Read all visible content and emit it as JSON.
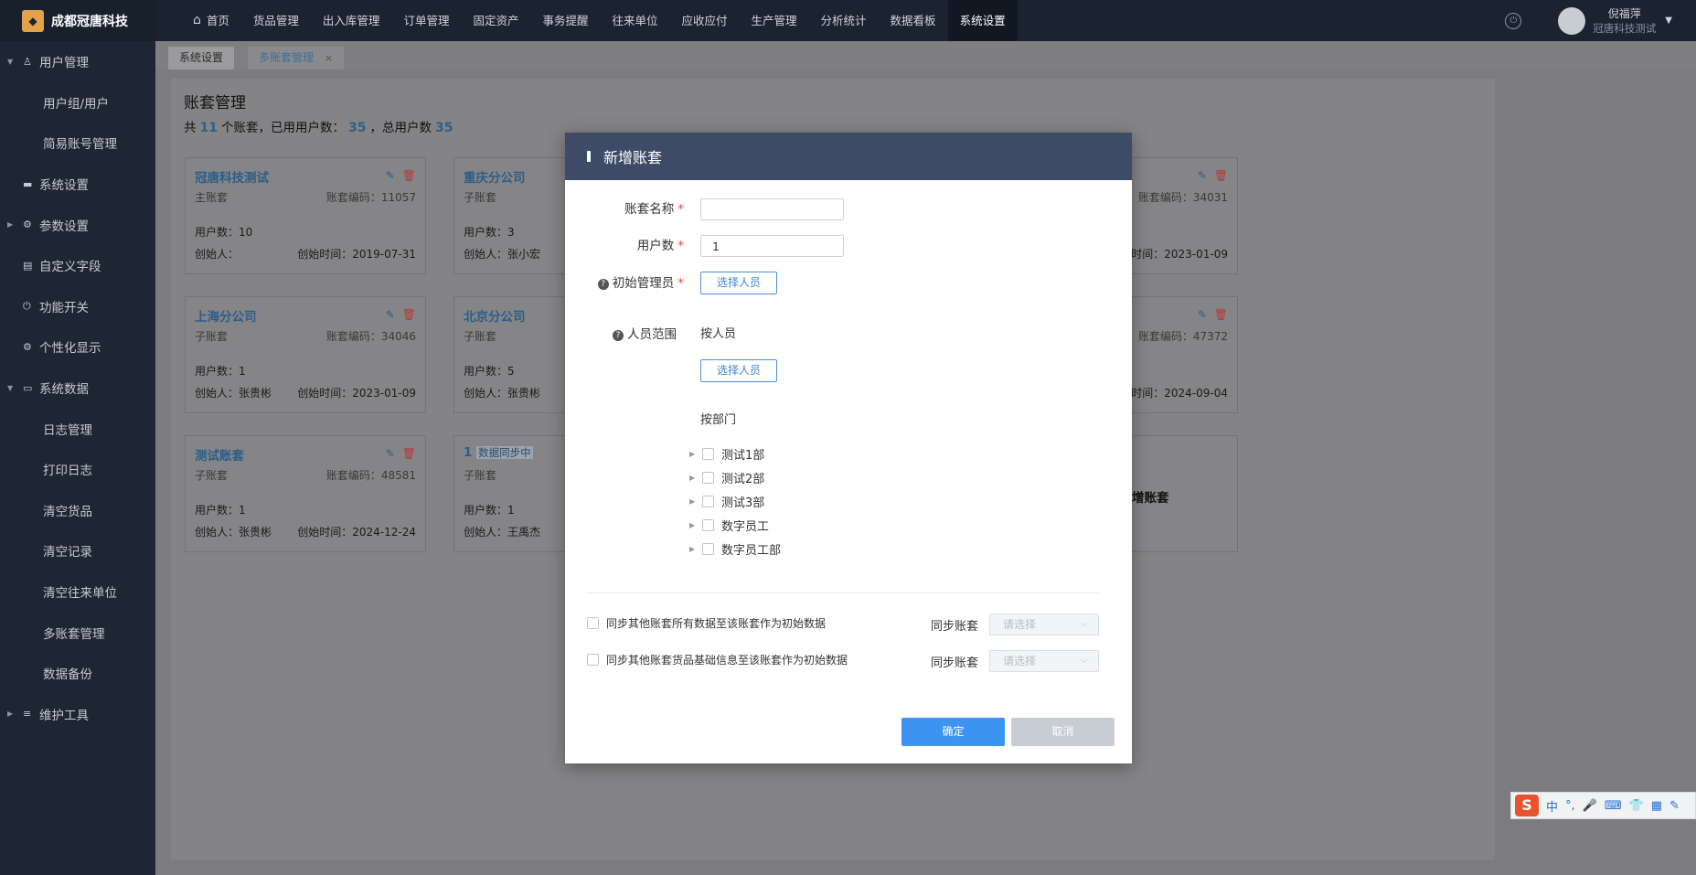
{
  "app": {
    "brand": "成都冠唐科技",
    "logo_glyph": "◆"
  },
  "topnav": {
    "items": [
      {
        "label": "首页",
        "icon": "home-icon"
      },
      {
        "label": "货品管理"
      },
      {
        "label": "出入库管理"
      },
      {
        "label": "订单管理"
      },
      {
        "label": "固定资产"
      },
      {
        "label": "事务提醒"
      },
      {
        "label": "往来单位"
      },
      {
        "label": "应收应付"
      },
      {
        "label": "生产管理"
      },
      {
        "label": "分析统计"
      },
      {
        "label": "数据看板"
      },
      {
        "label": "系统设置",
        "active": true
      }
    ]
  },
  "user": {
    "name": "倪福萍",
    "company": "冠唐科技测试",
    "caret": "▼",
    "help_glyph": "⏻"
  },
  "sidebar": {
    "items": [
      {
        "label": "用户管理",
        "icon": "user-icon",
        "arrow": "▼",
        "glyph": "♙"
      },
      {
        "label": "用户组/用户",
        "child": true
      },
      {
        "label": "简易账号管理",
        "child": true
      },
      {
        "label": "系统设置",
        "icon": "monitor-icon",
        "glyph": "▬"
      },
      {
        "label": "参数设置",
        "icon": "gear-icon",
        "arrow": "▶",
        "glyph": "⚙"
      },
      {
        "label": "自定义字段",
        "icon": "form-icon",
        "glyph": "▤"
      },
      {
        "label": "功能开关",
        "icon": "power-icon",
        "glyph": "⏻"
      },
      {
        "label": "个性化显示",
        "icon": "settings-icon",
        "glyph": "⚙"
      },
      {
        "label": "系统数据",
        "icon": "data-icon",
        "arrow": "▼",
        "glyph": "▭"
      },
      {
        "label": "日志管理",
        "child": true
      },
      {
        "label": "打印日志",
        "child": true
      },
      {
        "label": "清空货品",
        "child": true
      },
      {
        "label": "清空记录",
        "child": true
      },
      {
        "label": "清空往来单位",
        "child": true
      },
      {
        "label": "多账套管理",
        "child": true
      },
      {
        "label": "数据备份",
        "child": true
      },
      {
        "label": "维护工具",
        "icon": "database-icon",
        "arrow": "▶",
        "glyph": "≡"
      }
    ]
  },
  "tabs": [
    {
      "label": "系统设置"
    },
    {
      "label": "多账套管理",
      "active": true,
      "close": "×"
    }
  ],
  "panel": {
    "title": "账套管理",
    "summary_prefix": "共",
    "total_sets": "11",
    "summary_mid1": "个账套，已用用户数：",
    "used_users": "35",
    "summary_mid2": "，总用户数",
    "total_users": "35"
  },
  "cards": [
    {
      "name": "冠唐科技测试",
      "type": "主账套",
      "code": "账套编码：11057",
      "users": "用户数：10",
      "creator": "创始人：",
      "date": "创始时间：2019-07-31"
    },
    {
      "name": "重庆分公司",
      "type": "子账套",
      "code": "",
      "users": "用户数：3",
      "creator": "创始人：张小宏",
      "date": ""
    },
    {
      "name": "",
      "type": "",
      "code": "账套编码：34031",
      "users": "",
      "creator": "",
      "date": "时间：2023-01-09"
    },
    {
      "name": "上海分公司",
      "type": "子账套",
      "code": "账套编码：34046",
      "users": "用户数：1",
      "creator": "创始人：张贵彬",
      "date": "创始时间：2023-01-09"
    },
    {
      "name": "北京分公司",
      "type": "子账套",
      "code": "",
      "users": "用户数：5",
      "creator": "创始人：张贵彬",
      "date": ""
    },
    {
      "name": "",
      "type": "",
      "code": "账套编码：47372",
      "users": "",
      "creator": "",
      "date": "时间：2024-09-04"
    },
    {
      "name": "测试账套",
      "type": "子账套",
      "code": "账套编码：48581",
      "users": "用户数：1",
      "creator": "创始人：张贵彬",
      "date": "创始时间：2024-12-24"
    },
    {
      "name": "1",
      "badge": "数据同步中",
      "type": "子账套",
      "code": "",
      "users": "用户数：1",
      "creator": "创始人：王禹杰",
      "date": ""
    }
  ],
  "add_card": {
    "label": "增账套"
  },
  "icons": {
    "edit": "✎",
    "delete": "🗑",
    "question": "?",
    "tree_arrow": "▶",
    "dropdown_caret": "⌵"
  },
  "modal": {
    "title": "新增账套",
    "fields": {
      "name_label": "账套名称",
      "name_value": "",
      "users_label": "用户数",
      "users_value": "1",
      "admin_label": "初始管理员",
      "required_mark": "*",
      "scope_label": "人员范围",
      "by_person": "按人员",
      "by_dept": "按部门",
      "select_person": "选择人员"
    },
    "departments": [
      "测试1部",
      "测试2部",
      "测试3部",
      "数字员工",
      "数字员工部"
    ],
    "sync": [
      {
        "label": "同步其他账套所有数据至该账套作为初始数据",
        "sync_label": "同步账套",
        "placeholder": "请选择"
      },
      {
        "label": "同步其他账套货品基础信息至该账套作为初始数据",
        "sync_label": "同步账套",
        "placeholder": "请选择"
      }
    ],
    "ok": "确定",
    "cancel": "取消"
  },
  "ime": {
    "logo": "S",
    "mode": "中",
    "punct": "°,",
    "items": [
      "mic-icon",
      "keyboard-icon",
      "skin-icon",
      "apps-icon",
      "tools-icon"
    ],
    "glyphs": [
      "🎤",
      "⌨",
      "👕",
      "▦",
      "✎"
    ]
  },
  "colors": {
    "accent": "#3d93f0",
    "header": "#3d4b66",
    "danger": "#e54545",
    "link": "#2d5c88"
  }
}
